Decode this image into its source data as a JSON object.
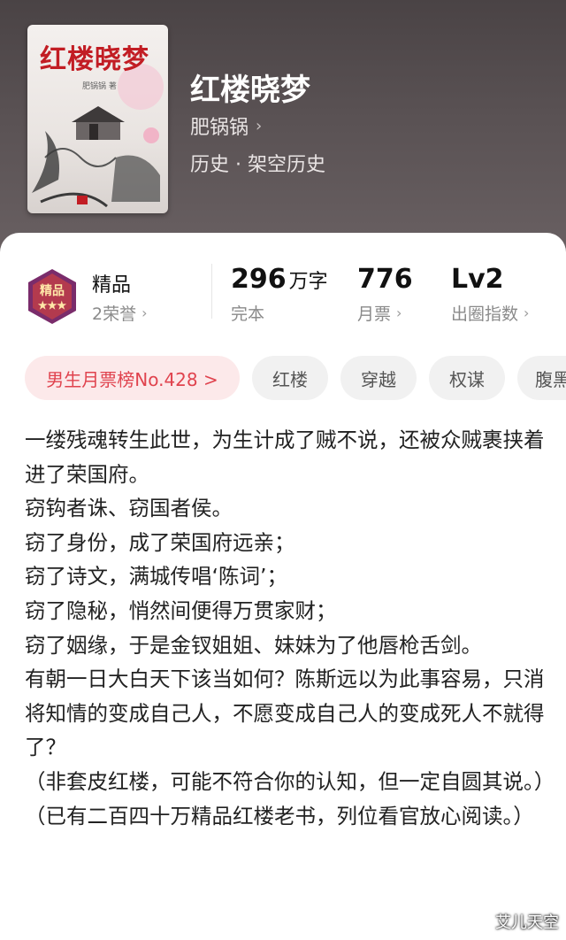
{
  "book": {
    "title": "红楼晓梦",
    "author": "肥锅锅",
    "author_chevron": "›",
    "genre": "历史 · 架空历史",
    "cover": {
      "title": "红楼晓梦",
      "author_caption": "肥锅锅 著"
    }
  },
  "stats": {
    "quality": {
      "label": "精品",
      "sub": "2荣誉"
    },
    "words": {
      "value": "296",
      "unit": "万字",
      "sub": "完本"
    },
    "tickets": {
      "value": "776",
      "sub": "月票"
    },
    "level": {
      "value": "Lv2",
      "sub": "出圈指数"
    },
    "chevron": "›"
  },
  "tags": {
    "rank": "男生月票榜No.428 >",
    "items": [
      "红楼",
      "穿越",
      "权谋",
      "腹黑"
    ]
  },
  "description": [
    "一缕残魂转生此世，为生计成了贼不说，还被众贼裹挟着进了荣国府。",
    "窃钩者诛、窃国者侯。",
    "窃了身份，成了荣国府远亲；",
    "窃了诗文，满城传唱‘陈词’；",
    "窃了隐秘，悄然间便得万贯家财；",
    "窃了姻缘，于是金钗姐姐、妹妹为了他唇枪舌剑。",
    "有朝一日大白天下该当如何？陈斯远以为此事容易，只消将知情的变成自己人，不愿变成自己人的变成死人不就得了？",
    "（非套皮红楼，可能不符合你的认知，但一定自圆其说。）",
    "（已有二百四十万精品红楼老书，列位看官放心阅读。）"
  ],
  "watermark": "艾儿天空",
  "colors": {
    "accent_red": "#e0434e",
    "header_bg": "#4a4345",
    "badge_purple": "#7a2c6b"
  }
}
